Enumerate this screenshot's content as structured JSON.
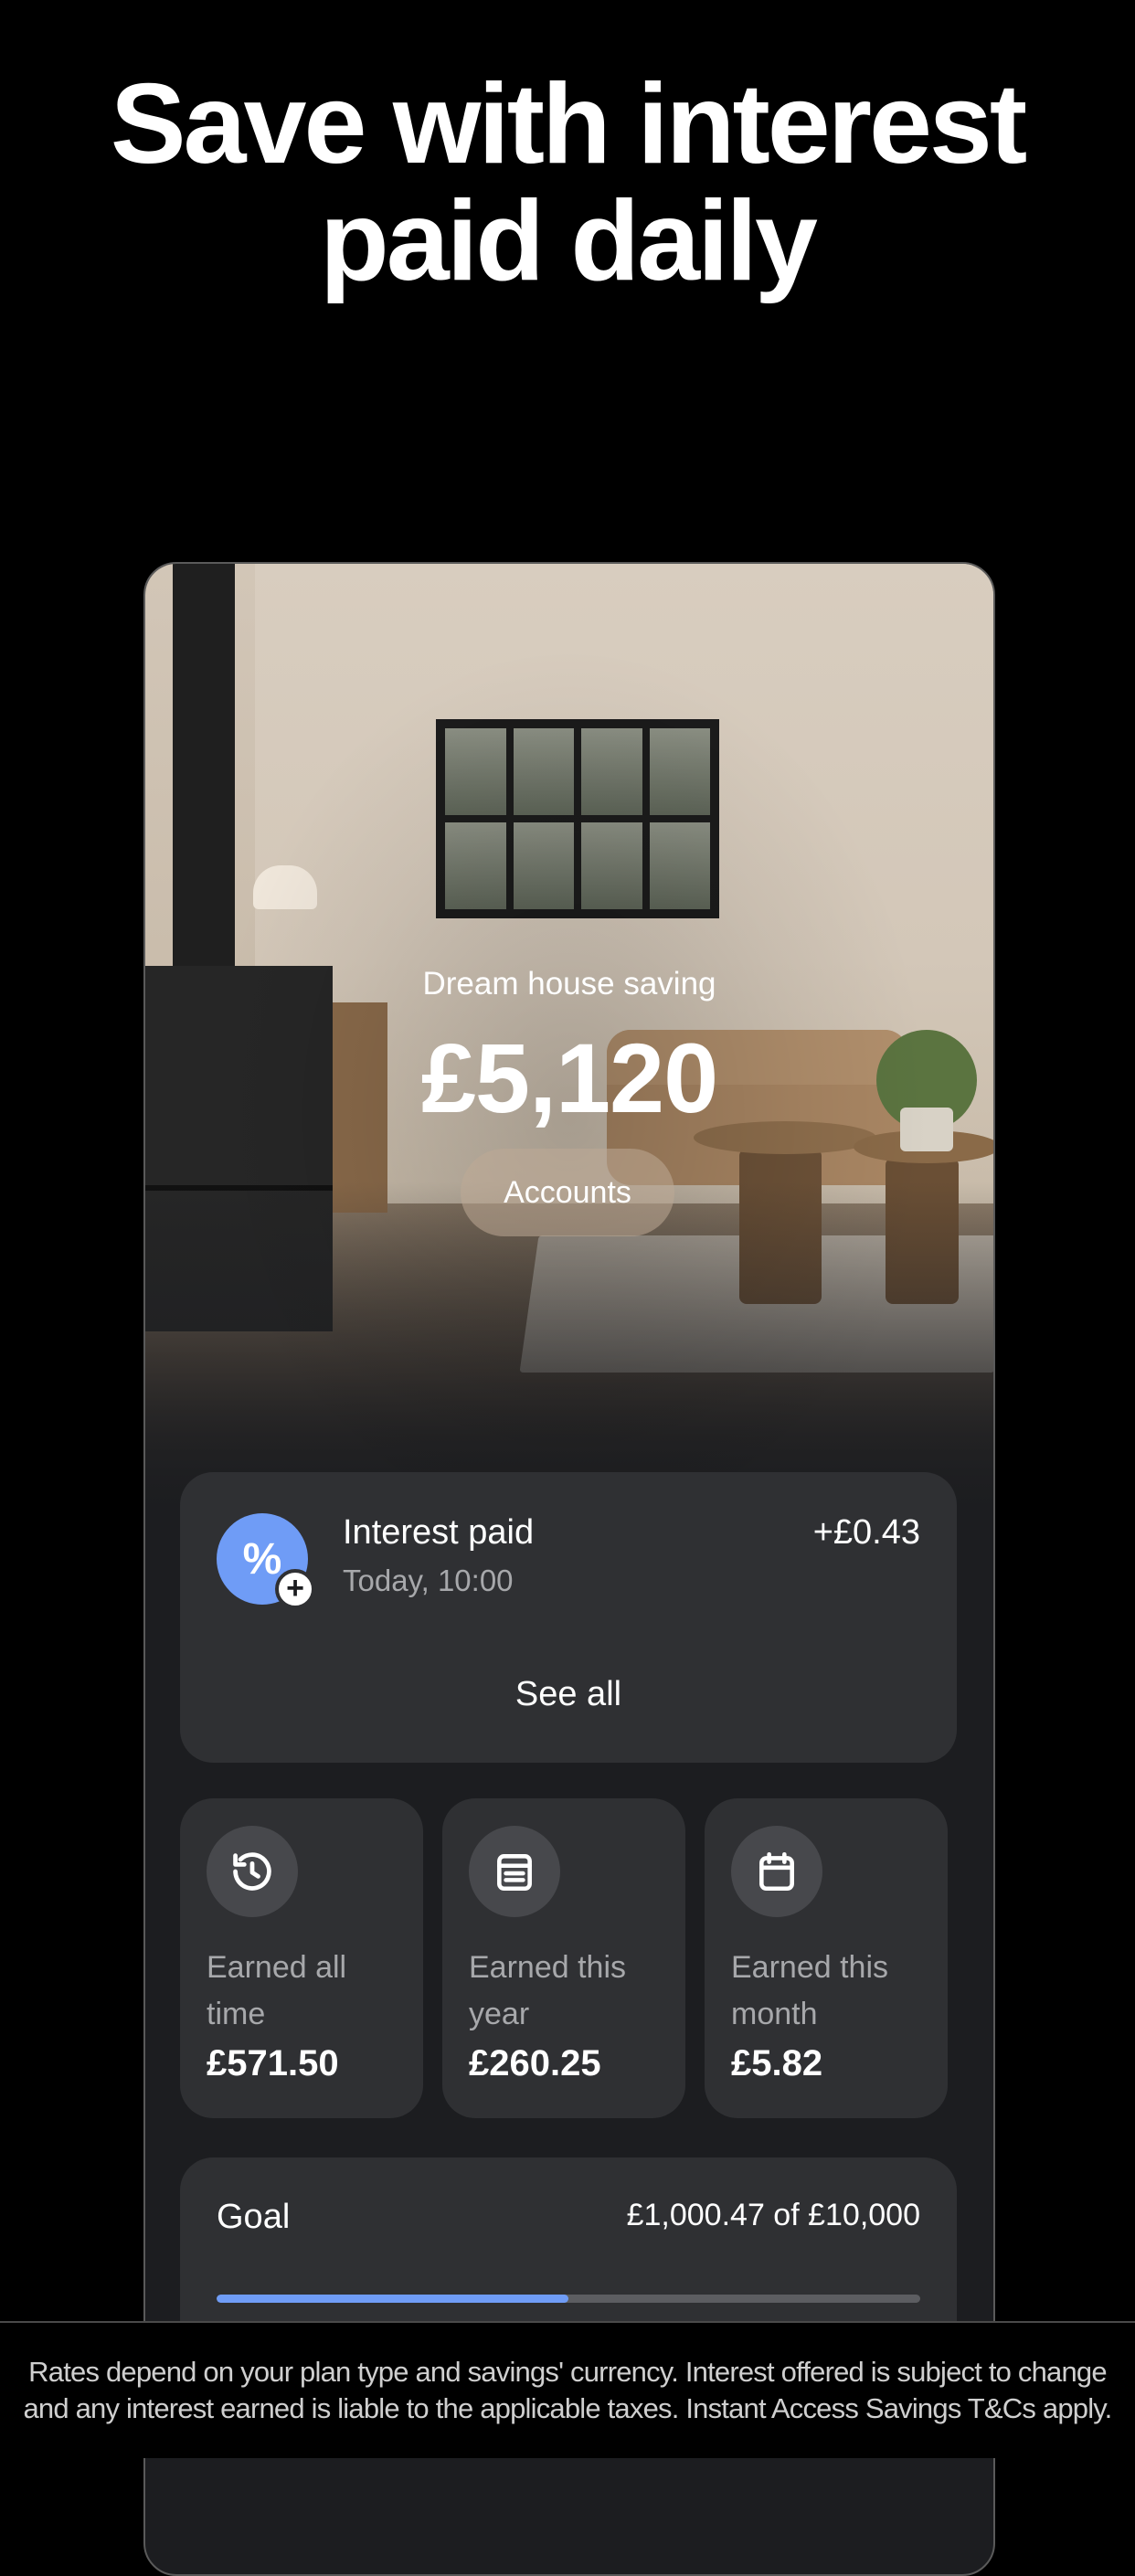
{
  "headline": {
    "line1": "Save with interest",
    "line2": "paid daily"
  },
  "hero": {
    "label": "Dream house saving",
    "amount": "£5,120",
    "accounts_button": "Accounts"
  },
  "interest": {
    "icon": "percent-icon",
    "title": "Interest paid",
    "time": "Today, 10:00",
    "amount": "+£0.43",
    "see_all": "See all"
  },
  "stats": [
    {
      "icon": "history-icon",
      "label": "Earned all time",
      "value": "£571.50"
    },
    {
      "icon": "calendar-year-icon",
      "label": "Earned this year",
      "value": "£260.25"
    },
    {
      "icon": "calendar-month-icon",
      "label": "Earned this month",
      "value": "£5.82"
    }
  ],
  "goal": {
    "title": "Goal",
    "amount_text": "£1,000.47 of £10,000",
    "progress": 0.5
  },
  "footer": {
    "line1": "Rates depend on your plan type and savings' currency. Interest offered is subject to change",
    "line2": "and any interest earned is liable to the applicable taxes. Instant Access Savings T&Cs apply."
  },
  "colors": {
    "background": "#000000",
    "card": "#2f3033",
    "accent": "#6f9cf6",
    "muted_text": "#a7a8ab"
  }
}
